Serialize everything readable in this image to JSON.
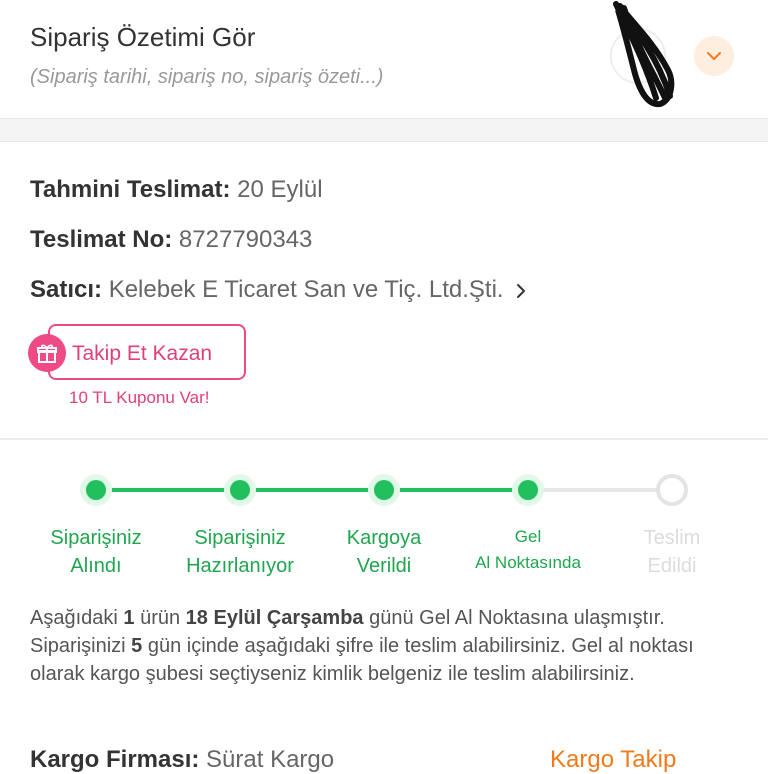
{
  "header": {
    "title": "Sipariş Özetimi Gör",
    "subtitle": "(Sipariş tarihi, sipariş no, sipariş özeti...)"
  },
  "delivery": {
    "estimated_label": "Tahmini Teslimat:",
    "estimated_value": "20 Eylül",
    "number_label": "Teslimat No:",
    "number_value": "8727790343",
    "seller_label": "Satıcı:",
    "seller_value": "Kelebek E Ticaret San ve Tiç. Ltd.Şti."
  },
  "follow": {
    "button_label": "Takip Et Kazan",
    "coupon_text": "10 TL Kuponu Var!"
  },
  "tracker": {
    "steps": [
      {
        "line1": "Siparişiniz",
        "line2": "Alındı",
        "done": true
      },
      {
        "line1": "Siparişiniz",
        "line2": "Hazırlanıyor",
        "done": true
      },
      {
        "line1": "Kargoya",
        "line2": "Verildi",
        "done": true
      },
      {
        "line1": "Gel",
        "line2": "Al Noktasında",
        "done": true
      },
      {
        "line1": "Teslim",
        "line2": "Edildi",
        "done": false
      }
    ],
    "progress": 0.75
  },
  "description": {
    "p1": "Aşağıdaki ",
    "count": "1",
    "p2": " ürün ",
    "date": "18 Eylül Çarşamba",
    "p3": " günü Gel Al Noktasına ulaşmıştır. Siparişinizi ",
    "days": "5",
    "p4": " gün içinde aşağıdaki şifre ile teslim alabilirsiniz. Gel al noktası olarak kargo şubesi seçtiyseniz kimlik belgeniz ile teslim alabilirsiniz."
  },
  "cargo": {
    "company_label": "Kargo Firması:",
    "company_value": "Sürat Kargo",
    "track_link": "Kargo Takip"
  },
  "colors": {
    "green": "#20c05c",
    "pink": "#ee4a86",
    "orange": "#f27a1a"
  },
  "icons": [
    "chevron-down-icon",
    "chevron-right-icon",
    "gift-icon"
  ]
}
